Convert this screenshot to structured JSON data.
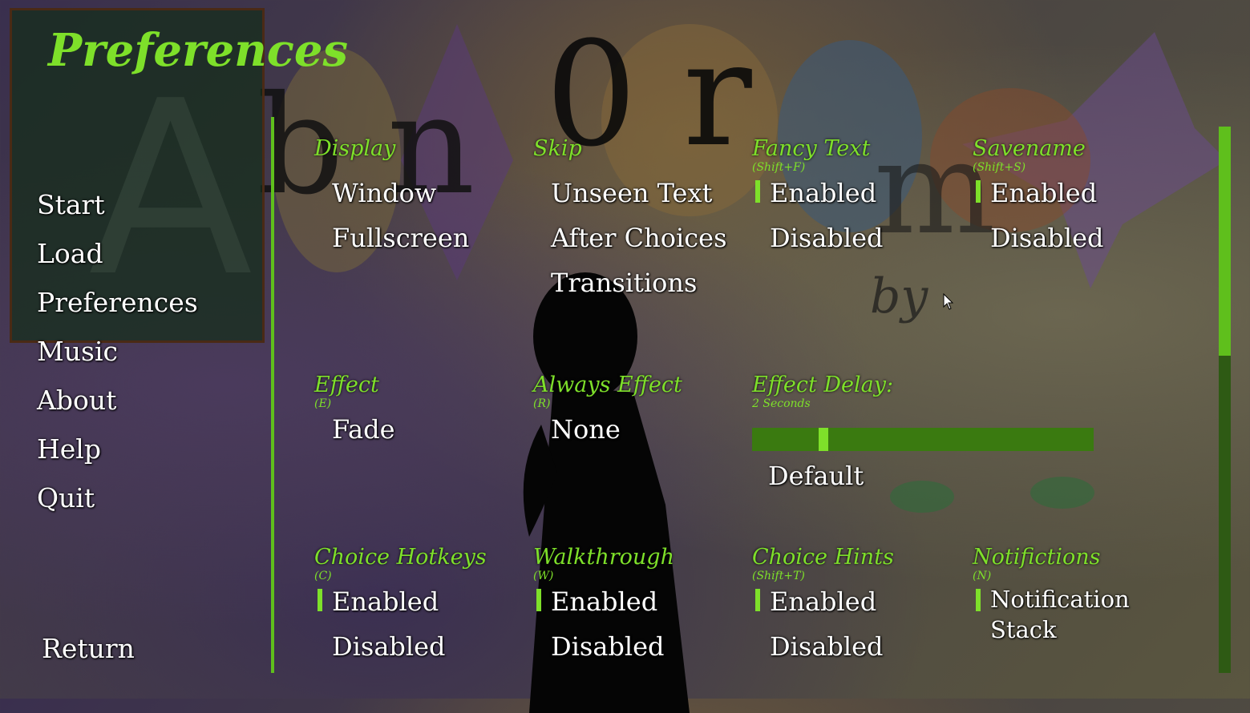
{
  "page_title": "Preferences",
  "nav": {
    "items": [
      "Start",
      "Load",
      "Preferences",
      "Music",
      "About",
      "Help",
      "Quit"
    ],
    "return_label": "Return"
  },
  "groups": {
    "display": {
      "label": "Display",
      "options": [
        "Window",
        "Fullscreen"
      ]
    },
    "skip": {
      "label": "Skip",
      "options": [
        "Unseen Text",
        "After Choices",
        "Transitions"
      ]
    },
    "fancy_text": {
      "label": "Fancy Text",
      "hotkey": "(Shift+F)",
      "options": [
        "Enabled",
        "Disabled"
      ]
    },
    "savename": {
      "label": "Savename",
      "hotkey": "(Shift+S)",
      "options": [
        "Enabled",
        "Disabled"
      ]
    },
    "effect": {
      "label": "Effect",
      "hotkey": "(E)",
      "options": [
        "Fade"
      ]
    },
    "always_effect": {
      "label": "Always Effect",
      "hotkey": "(R)",
      "options": [
        "None"
      ]
    },
    "effect_delay": {
      "label": "Effect Delay:",
      "value_text": "2 Seconds",
      "slider_fraction": 0.2,
      "default_label": "Default"
    },
    "choice_hotkeys": {
      "label": "Choice Hotkeys",
      "hotkey": "(C)",
      "options": [
        "Enabled",
        "Disabled"
      ]
    },
    "walkthrough": {
      "label": "Walkthrough",
      "hotkey": "(W)",
      "options": [
        "Enabled",
        "Disabled"
      ]
    },
    "choice_hints": {
      "label": "Choice Hints",
      "hotkey": "(Shift+T)",
      "options": [
        "Enabled",
        "Disabled"
      ]
    },
    "notifications": {
      "label": "Notifictions",
      "hotkey": "(N)",
      "options": [
        "Notification",
        "Stack"
      ]
    }
  },
  "colors": {
    "accent": "#7ee02a",
    "text": "#ffffff",
    "track": "#3a7a10"
  },
  "scrollbar_fraction": 0.42
}
